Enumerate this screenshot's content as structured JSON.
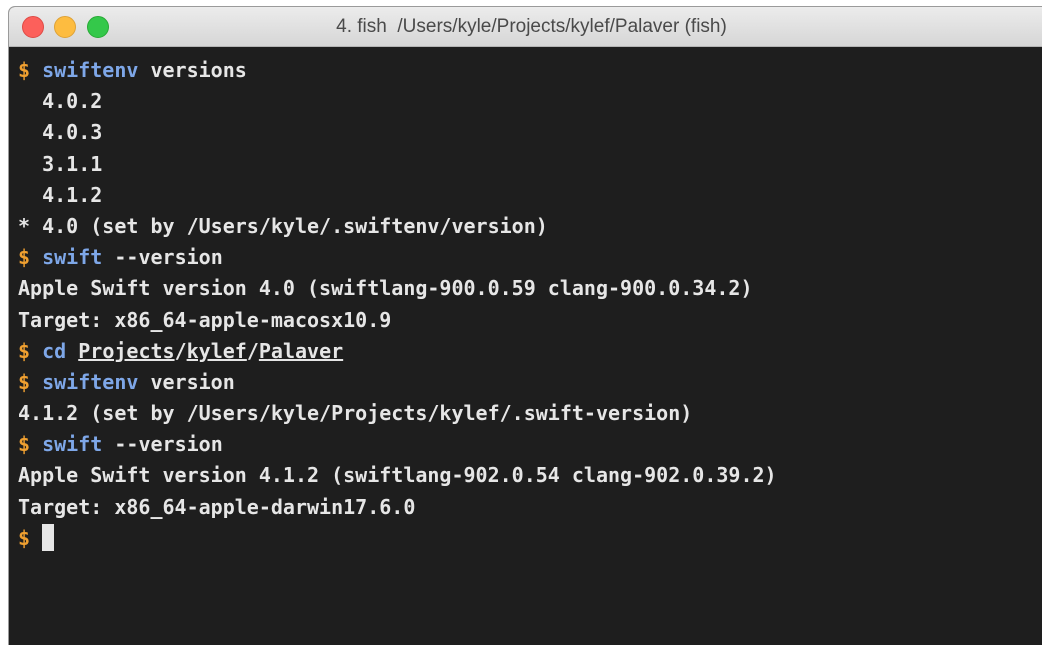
{
  "window": {
    "title": "4. fish  /Users/kyle/Projects/kylef/Palaver (fish)"
  },
  "terminal": {
    "prompt": "$",
    "cmd1": {
      "command": "swiftenv",
      "args": "versions"
    },
    "versions": [
      "4.0.2",
      "4.0.3",
      "3.1.1",
      "4.1.2"
    ],
    "current_version": "* 4.0 (set by /Users/kyle/.swiftenv/version)",
    "cmd2": {
      "command": "swift",
      "args": "--version"
    },
    "out2_line1": "Apple Swift version 4.0 (swiftlang-900.0.59 clang-900.0.34.2)",
    "out2_line2": "Target: x86_64-apple-macosx10.9",
    "cmd3": {
      "command": "cd",
      "path_parts": [
        "Projects",
        "kylef",
        "Palaver"
      ],
      "separator": "/"
    },
    "cmd4": {
      "command": "swiftenv",
      "args": "version"
    },
    "out4": "4.1.2 (set by /Users/kyle/Projects/kylef/.swift-version)",
    "cmd5": {
      "command": "swift",
      "args": "--version"
    },
    "out5_line1": "Apple Swift version 4.1.2 (swiftlang-902.0.54 clang-902.0.39.2)",
    "out5_line2": "Target: x86_64-apple-darwin17.6.0"
  },
  "colors": {
    "prompt": "#f0a030",
    "command": "#7ea7e8",
    "text": "#e6e6e6",
    "background": "#1e1e1e"
  }
}
